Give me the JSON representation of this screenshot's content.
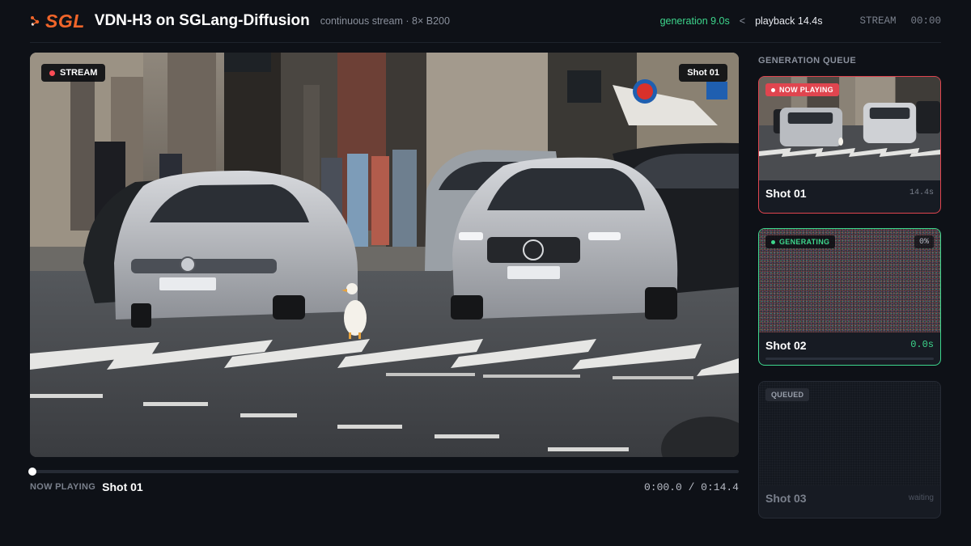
{
  "header": {
    "logo_text": "SGL",
    "title": "VDN-H3 on SGLang-Diffusion",
    "subtitle": "continuous stream · 8× B200",
    "generation": "generation 9.0s",
    "separator": "<",
    "playback": "playback 14.4s",
    "stream_label": "STREAM",
    "clock": "00:00"
  },
  "player": {
    "stream_badge": "STREAM",
    "shot_badge": "Shot 01",
    "now_playing_label": "NOW PLAYING",
    "now_playing_shot": "Shot 01",
    "time": "0:00.0 / 0:14.4",
    "progress_fraction": 0.0
  },
  "queue": {
    "title": "GENERATION QUEUE",
    "cards": [
      {
        "status": "NOW PLAYING",
        "name": "Shot 01",
        "meta": "14.4s"
      },
      {
        "status": "GENERATING",
        "name": "Shot 02",
        "meta": "0.0s",
        "percent": "0%",
        "progress_fraction": 0.0
      },
      {
        "status": "QUEUED",
        "name": "Shot 03",
        "meta": "waiting"
      }
    ]
  },
  "colors": {
    "accent_orange": "#f0652a",
    "playing_red": "#e0454f",
    "generating_green": "#3dd68c",
    "background": "#0e1117"
  },
  "icons": {
    "logo": "sgl-logo-icon",
    "live_dot": "red-dot-icon",
    "generating_dot": "green-dot-icon"
  }
}
